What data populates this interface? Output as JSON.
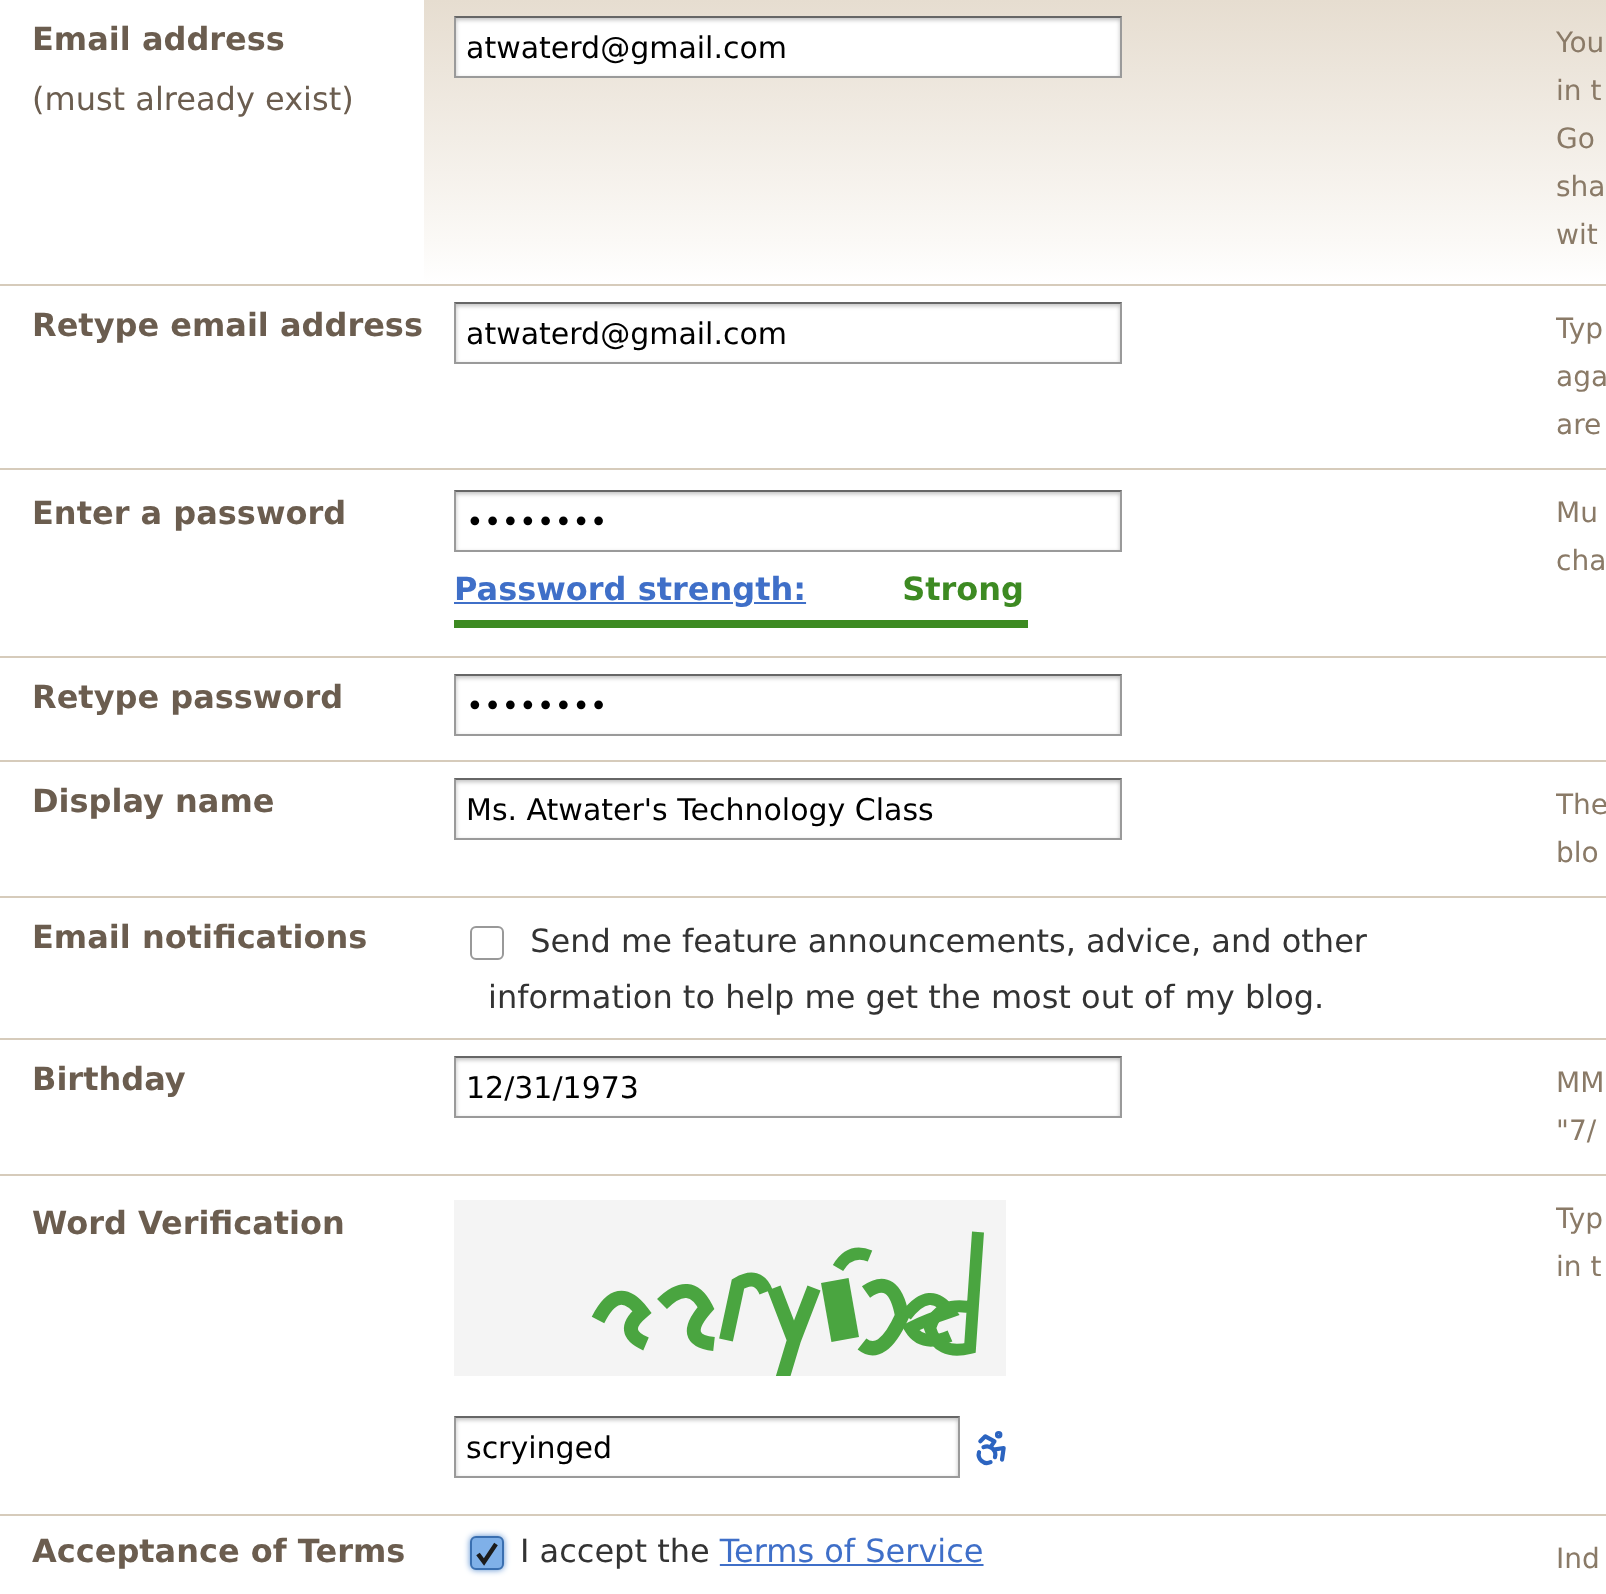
{
  "rows": [
    {
      "kind": "text",
      "label": "Email address",
      "sublabel": "(must already exist)",
      "value": "atwaterd@gmail.com",
      "help": [
        "You",
        "in t",
        "Go",
        "sha",
        "wit"
      ],
      "highlighted": true
    },
    {
      "kind": "text",
      "label": "Retype email address",
      "value": "atwaterd@gmail.com",
      "help": [
        "Typ",
        "aga",
        "are"
      ],
      "highlighted": false
    },
    {
      "kind": "password",
      "label": "Enter a password",
      "value": "••••••••",
      "strength_label": "Password strength:",
      "strength": "Strong",
      "level": 1,
      "help": [
        "Mu",
        "cha"
      ],
      "highlighted": false
    },
    {
      "kind": "text",
      "label": "Retype password",
      "value": "••••••••",
      "help": [],
      "highlighted": false
    },
    {
      "kind": "text",
      "label": "Display name",
      "value": "Ms. Atwater's Technology Class",
      "help": [
        "The",
        "blo"
      ],
      "highlighted": false
    },
    {
      "kind": "checkbox",
      "label": "Email notifications",
      "checked": false,
      "text": "Send me feature announcements, advice, and other information to help me get the most out of my blog.",
      "help": [],
      "highlighted": false
    },
    {
      "kind": "text",
      "label": "Birthday",
      "value": "12/31/1973",
      "help": [
        "MM",
        "\"7/"
      ],
      "highlighted": false
    },
    {
      "kind": "captcha",
      "label": "Word Verification",
      "value": "scryinged",
      "help": [
        "Typ",
        "in t"
      ],
      "highlighted": false
    },
    {
      "kind": "terms",
      "label": "Acceptance of Terms",
      "checked": true,
      "text": "I accept the",
      "link": "Terms of Service",
      "help": [
        "Ind"
      ],
      "highlighted": false
    }
  ]
}
